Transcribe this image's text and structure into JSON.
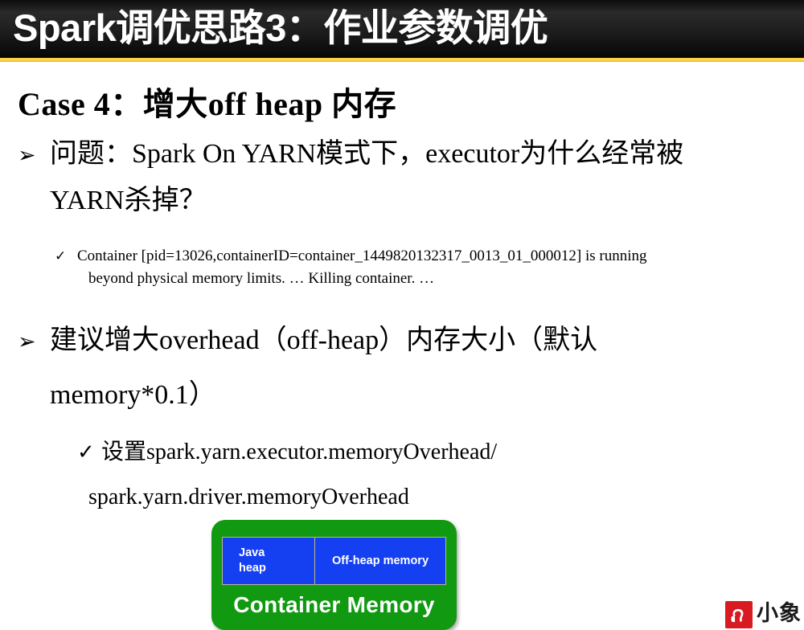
{
  "slide": {
    "title": "Spark调优思路3：作业参数调优",
    "accent_dark": "#141414",
    "accent_yellow": "#f5cb2b",
    "heading": "Case 4：增大off heap  内存"
  },
  "content": {
    "bullet1": {
      "marker": "➢",
      "line1": "问题：Spark On YARN模式下，executor为什么经常被",
      "line2": "YARN杀掉？"
    },
    "sub1": {
      "marker": "✓",
      "line1": "Container [pid=13026,containerID=container_1449820132317_0013_01_000012] is running",
      "line2": "beyond physical memory limits. … Killing container. …"
    },
    "bullet2": {
      "marker": "➢",
      "line1": "建议增大overhead（off-heap）内存大小（默认",
      "line2": "memory*0.1）"
    },
    "sub2": {
      "marker": "✓",
      "line1": "设置spark.yarn.executor.memoryOverhead/",
      "line2": "spark.yarn.driver.memoryOverhead"
    }
  },
  "diagram": {
    "java_heap_label": "Java\nheap",
    "java_heap_line1": "Java",
    "java_heap_line2": "heap",
    "off_heap_label": "Off-heap memory",
    "container_label": "Container Memory",
    "container_color": "#119911",
    "block_color": "#1540f2"
  },
  "logo": {
    "word": "小象",
    "mark_color": "#d81b21",
    "icon": "elephant-icon"
  }
}
